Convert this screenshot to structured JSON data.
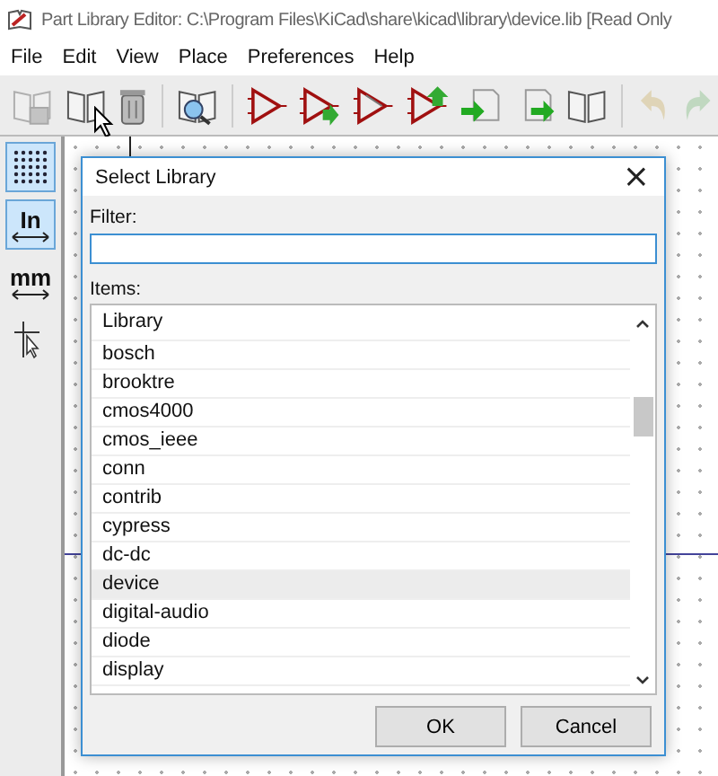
{
  "window": {
    "title": "Part Library Editor: C:\\Program Files\\KiCad\\share\\kicad\\library\\device.lib [Read Only"
  },
  "menu": [
    "File",
    "Edit",
    "View",
    "Place",
    "Preferences",
    "Help"
  ],
  "toolbar": [
    {
      "kind": "book-save",
      "disabled": true
    },
    {
      "kind": "book",
      "disabled": false
    },
    {
      "kind": "trash",
      "disabled": false
    },
    {
      "kind": "separator"
    },
    {
      "kind": "book-search",
      "disabled": false
    },
    {
      "kind": "separator"
    },
    {
      "kind": "triangle",
      "disabled": false
    },
    {
      "kind": "triangle-arrow",
      "disabled": false
    },
    {
      "kind": "triangle-double",
      "disabled": false
    },
    {
      "kind": "triangle-up",
      "disabled": false
    },
    {
      "kind": "page-import",
      "disabled": false
    },
    {
      "kind": "page-export",
      "disabled": false
    },
    {
      "kind": "book",
      "disabled": false
    },
    {
      "kind": "separator"
    },
    {
      "kind": "undo",
      "disabled": true
    },
    {
      "kind": "redo",
      "disabled": true
    }
  ],
  "left_tools": [
    {
      "kind": "grid",
      "selected": true
    },
    {
      "kind": "inch",
      "label": "In",
      "selected": true
    },
    {
      "kind": "mm",
      "label": "mm",
      "selected": false
    },
    {
      "kind": "cursor",
      "selected": false
    }
  ],
  "dialog": {
    "title": "Select Library",
    "close": "×",
    "filter_label": "Filter:",
    "items_label": "Items:",
    "list": {
      "header": "Library",
      "items": [
        {
          "label": "bosch",
          "selected": false
        },
        {
          "label": "brooktre",
          "selected": false
        },
        {
          "label": "cmos4000",
          "selected": false
        },
        {
          "label": "cmos_ieee",
          "selected": false
        },
        {
          "label": "conn",
          "selected": false
        },
        {
          "label": "contrib",
          "selected": false
        },
        {
          "label": "cypress",
          "selected": false
        },
        {
          "label": "dc-dc",
          "selected": false
        },
        {
          "label": "device",
          "selected": true
        },
        {
          "label": "digital-audio",
          "selected": false
        },
        {
          "label": "diode",
          "selected": false
        },
        {
          "label": "display",
          "selected": false
        }
      ]
    },
    "buttons": [
      "OK",
      "Cancel"
    ]
  }
}
